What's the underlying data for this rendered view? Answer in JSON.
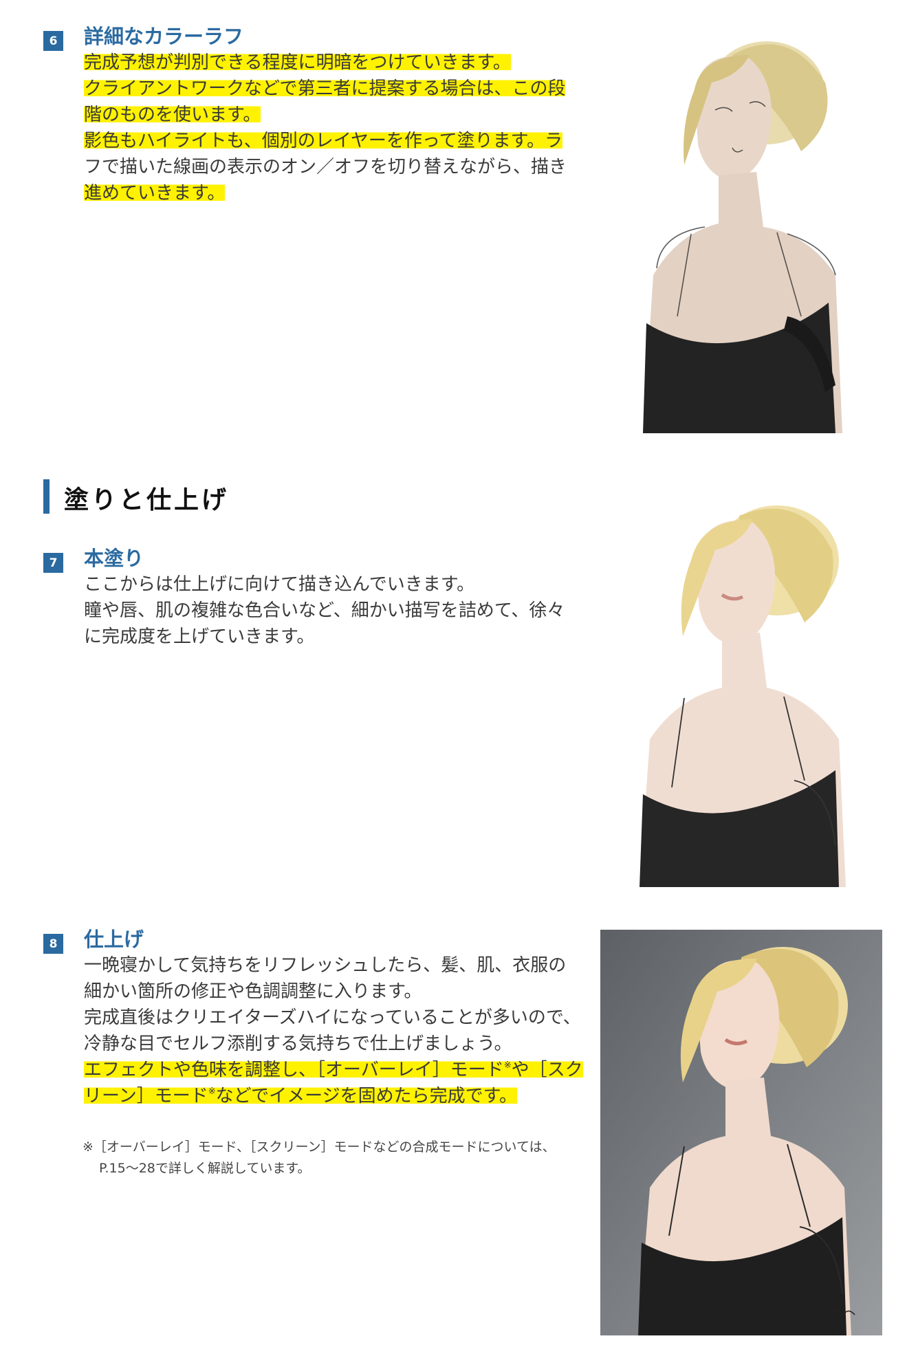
{
  "steps": [
    {
      "number": "6",
      "title": "詳細なカラーラフ",
      "lines": [
        "完成予想が判別できる程度に明暗をつけていきます。",
        "クライアントワークなどで第三者に提案する場合は、この段",
        "階のものを使います。",
        "影色もハイライトも、個別のレイヤーを作って塗ります。ラ",
        "フで描いた線画の表示のオン／オフを切り替えながら、描き",
        "進めていきます。"
      ]
    },
    {
      "number": "7",
      "title": "本塗り",
      "lines": [
        "ここからは仕上げに向けて描き込んでいきます。",
        "瞳や唇、肌の複雑な色合いなど、細かい描写を詰めて、徐々",
        "に完成度を上げていきます。"
      ]
    },
    {
      "number": "8",
      "title": "仕上げ",
      "lines": [
        "一晩寝かして気持ちをリフレッシュしたら、髪、肌、衣服の",
        "細かい箇所の修正や色調調整に入ります。",
        "完成直後はクリエイターズハイになっていることが多いので、",
        "冷静な目でセルフ添削する気持ちで仕上げましょう。",
        "エフェクトや色味を調整し、［オーバーレイ］モード※や［スク",
        "リーン］モード※などでイメージを固めたら完成です。"
      ]
    }
  ],
  "section_title": "塗りと仕上げ",
  "note_lines": [
    "※［オーバーレイ］モード、［スクリーン］モードなどの合成モードについては、",
    "P.15～28で詳しく解説しています。"
  ],
  "colors": {
    "accent": "#2b6aa0",
    "highlight": "#fff200",
    "text": "#3a3a3a"
  }
}
